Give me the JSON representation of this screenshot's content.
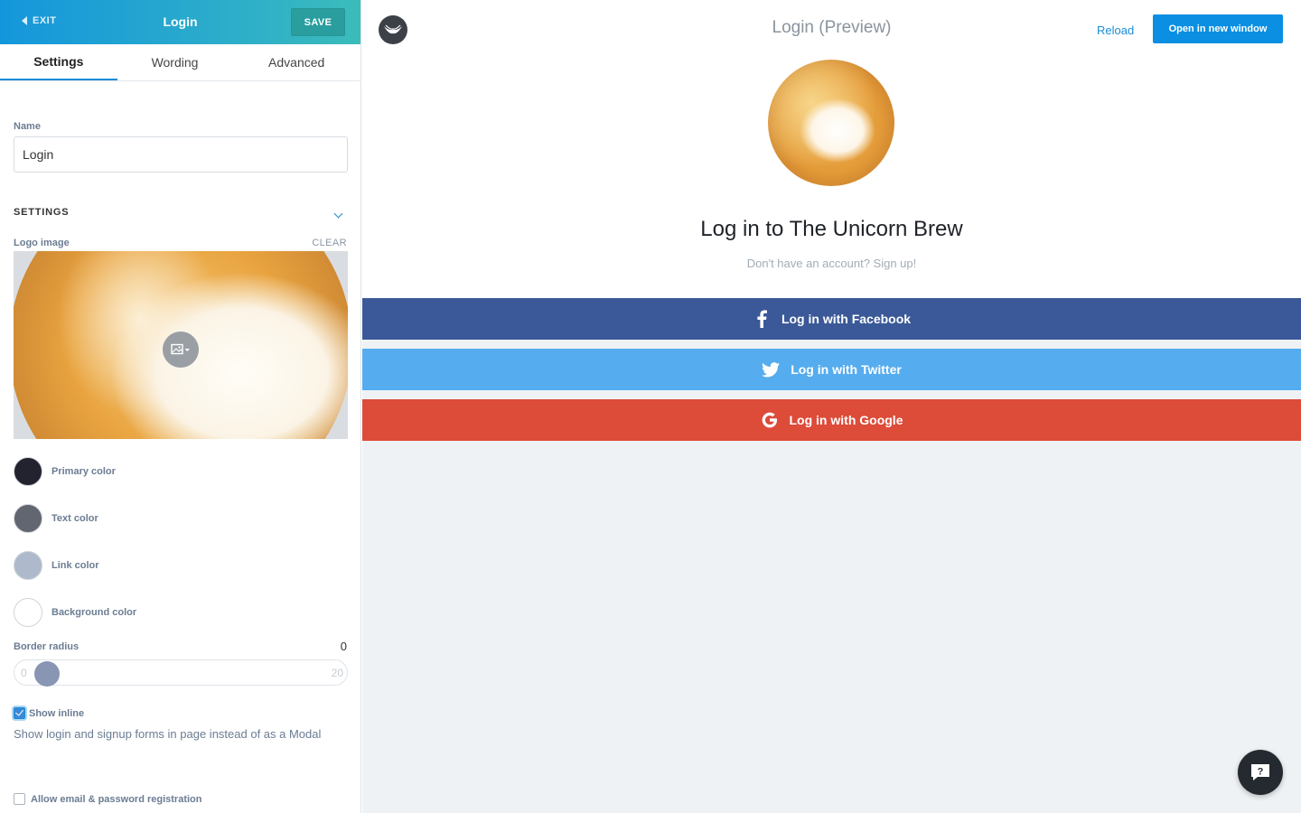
{
  "sidebar": {
    "exit_label": "EXIT",
    "title": "Login",
    "save_label": "SAVE",
    "tabs": [
      {
        "label": "Settings",
        "active": true
      },
      {
        "label": "Wording",
        "active": false
      },
      {
        "label": "Advanced",
        "active": false
      }
    ],
    "name_label": "Name",
    "name_value": "Login",
    "section_title": "SETTINGS",
    "logo_label": "Logo image",
    "clear_label": "CLEAR",
    "colors": [
      {
        "label": "Primary color",
        "hex": "#23232f"
      },
      {
        "label": "Text color",
        "hex": "#616670"
      },
      {
        "label": "Link color",
        "hex": "#aebacb"
      },
      {
        "label": "Background color",
        "hex": "#ffffff"
      }
    ],
    "border_radius": {
      "label": "Border radius",
      "value": "0",
      "min": "0",
      "max": "20"
    },
    "show_inline": {
      "label": "Show inline",
      "checked": true,
      "description": "Show login and signup forms in page instead of as a Modal"
    },
    "allow_email": {
      "label": "Allow email & password registration",
      "checked": false
    }
  },
  "preview": {
    "title": "Login (Preview)",
    "reload_label": "Reload",
    "open_label": "Open in new window",
    "heading": "Log in to The Unicorn Brew",
    "signup_text": "Don't have an account? Sign up!",
    "buttons": [
      {
        "label": "Log in with Facebook",
        "icon": "facebook-icon",
        "color": "#3b5998"
      },
      {
        "label": "Log in with Twitter",
        "icon": "twitter-icon",
        "color": "#55acee"
      },
      {
        "label": "Log in with Google",
        "icon": "google-icon",
        "color": "#dd4b39"
      }
    ],
    "help_icon": "help-chat-icon"
  }
}
